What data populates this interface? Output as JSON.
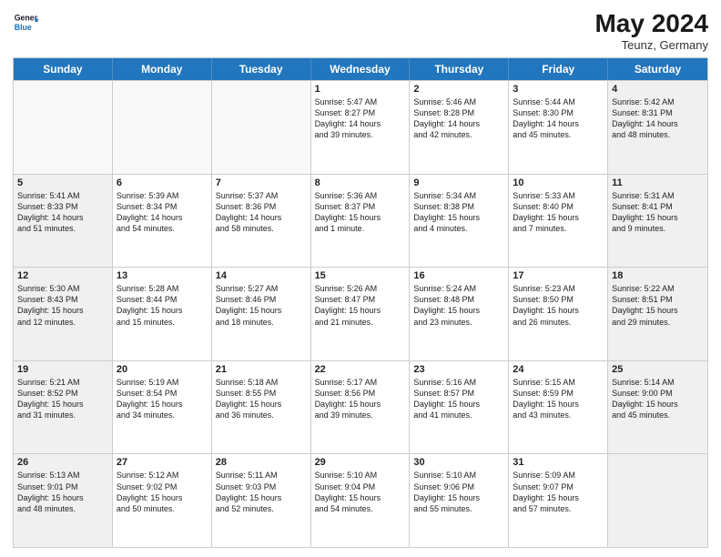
{
  "header": {
    "logo_line1": "General",
    "logo_line2": "Blue",
    "month": "May 2024",
    "location": "Teunz, Germany"
  },
  "days_of_week": [
    "Sunday",
    "Monday",
    "Tuesday",
    "Wednesday",
    "Thursday",
    "Friday",
    "Saturday"
  ],
  "weeks": [
    [
      {
        "day": "",
        "text": "",
        "empty": true
      },
      {
        "day": "",
        "text": "",
        "empty": true
      },
      {
        "day": "",
        "text": "",
        "empty": true
      },
      {
        "day": "1",
        "text": "Sunrise: 5:47 AM\nSunset: 8:27 PM\nDaylight: 14 hours\nand 39 minutes."
      },
      {
        "day": "2",
        "text": "Sunrise: 5:46 AM\nSunset: 8:28 PM\nDaylight: 14 hours\nand 42 minutes."
      },
      {
        "day": "3",
        "text": "Sunrise: 5:44 AM\nSunset: 8:30 PM\nDaylight: 14 hours\nand 45 minutes."
      },
      {
        "day": "4",
        "text": "Sunrise: 5:42 AM\nSunset: 8:31 PM\nDaylight: 14 hours\nand 48 minutes.",
        "shaded": true
      }
    ],
    [
      {
        "day": "5",
        "text": "Sunrise: 5:41 AM\nSunset: 8:33 PM\nDaylight: 14 hours\nand 51 minutes.",
        "shaded": true
      },
      {
        "day": "6",
        "text": "Sunrise: 5:39 AM\nSunset: 8:34 PM\nDaylight: 14 hours\nand 54 minutes."
      },
      {
        "day": "7",
        "text": "Sunrise: 5:37 AM\nSunset: 8:36 PM\nDaylight: 14 hours\nand 58 minutes."
      },
      {
        "day": "8",
        "text": "Sunrise: 5:36 AM\nSunset: 8:37 PM\nDaylight: 15 hours\nand 1 minute."
      },
      {
        "day": "9",
        "text": "Sunrise: 5:34 AM\nSunset: 8:38 PM\nDaylight: 15 hours\nand 4 minutes."
      },
      {
        "day": "10",
        "text": "Sunrise: 5:33 AM\nSunset: 8:40 PM\nDaylight: 15 hours\nand 7 minutes."
      },
      {
        "day": "11",
        "text": "Sunrise: 5:31 AM\nSunset: 8:41 PM\nDaylight: 15 hours\nand 9 minutes.",
        "shaded": true
      }
    ],
    [
      {
        "day": "12",
        "text": "Sunrise: 5:30 AM\nSunset: 8:43 PM\nDaylight: 15 hours\nand 12 minutes.",
        "shaded": true
      },
      {
        "day": "13",
        "text": "Sunrise: 5:28 AM\nSunset: 8:44 PM\nDaylight: 15 hours\nand 15 minutes."
      },
      {
        "day": "14",
        "text": "Sunrise: 5:27 AM\nSunset: 8:46 PM\nDaylight: 15 hours\nand 18 minutes."
      },
      {
        "day": "15",
        "text": "Sunrise: 5:26 AM\nSunset: 8:47 PM\nDaylight: 15 hours\nand 21 minutes."
      },
      {
        "day": "16",
        "text": "Sunrise: 5:24 AM\nSunset: 8:48 PM\nDaylight: 15 hours\nand 23 minutes."
      },
      {
        "day": "17",
        "text": "Sunrise: 5:23 AM\nSunset: 8:50 PM\nDaylight: 15 hours\nand 26 minutes."
      },
      {
        "day": "18",
        "text": "Sunrise: 5:22 AM\nSunset: 8:51 PM\nDaylight: 15 hours\nand 29 minutes.",
        "shaded": true
      }
    ],
    [
      {
        "day": "19",
        "text": "Sunrise: 5:21 AM\nSunset: 8:52 PM\nDaylight: 15 hours\nand 31 minutes.",
        "shaded": true
      },
      {
        "day": "20",
        "text": "Sunrise: 5:19 AM\nSunset: 8:54 PM\nDaylight: 15 hours\nand 34 minutes."
      },
      {
        "day": "21",
        "text": "Sunrise: 5:18 AM\nSunset: 8:55 PM\nDaylight: 15 hours\nand 36 minutes."
      },
      {
        "day": "22",
        "text": "Sunrise: 5:17 AM\nSunset: 8:56 PM\nDaylight: 15 hours\nand 39 minutes."
      },
      {
        "day": "23",
        "text": "Sunrise: 5:16 AM\nSunset: 8:57 PM\nDaylight: 15 hours\nand 41 minutes."
      },
      {
        "day": "24",
        "text": "Sunrise: 5:15 AM\nSunset: 8:59 PM\nDaylight: 15 hours\nand 43 minutes."
      },
      {
        "day": "25",
        "text": "Sunrise: 5:14 AM\nSunset: 9:00 PM\nDaylight: 15 hours\nand 45 minutes.",
        "shaded": true
      }
    ],
    [
      {
        "day": "26",
        "text": "Sunrise: 5:13 AM\nSunset: 9:01 PM\nDaylight: 15 hours\nand 48 minutes.",
        "shaded": true
      },
      {
        "day": "27",
        "text": "Sunrise: 5:12 AM\nSunset: 9:02 PM\nDaylight: 15 hours\nand 50 minutes."
      },
      {
        "day": "28",
        "text": "Sunrise: 5:11 AM\nSunset: 9:03 PM\nDaylight: 15 hours\nand 52 minutes."
      },
      {
        "day": "29",
        "text": "Sunrise: 5:10 AM\nSunset: 9:04 PM\nDaylight: 15 hours\nand 54 minutes."
      },
      {
        "day": "30",
        "text": "Sunrise: 5:10 AM\nSunset: 9:06 PM\nDaylight: 15 hours\nand 55 minutes."
      },
      {
        "day": "31",
        "text": "Sunrise: 5:09 AM\nSunset: 9:07 PM\nDaylight: 15 hours\nand 57 minutes."
      },
      {
        "day": "",
        "text": "",
        "empty": true,
        "shaded": true
      }
    ]
  ]
}
